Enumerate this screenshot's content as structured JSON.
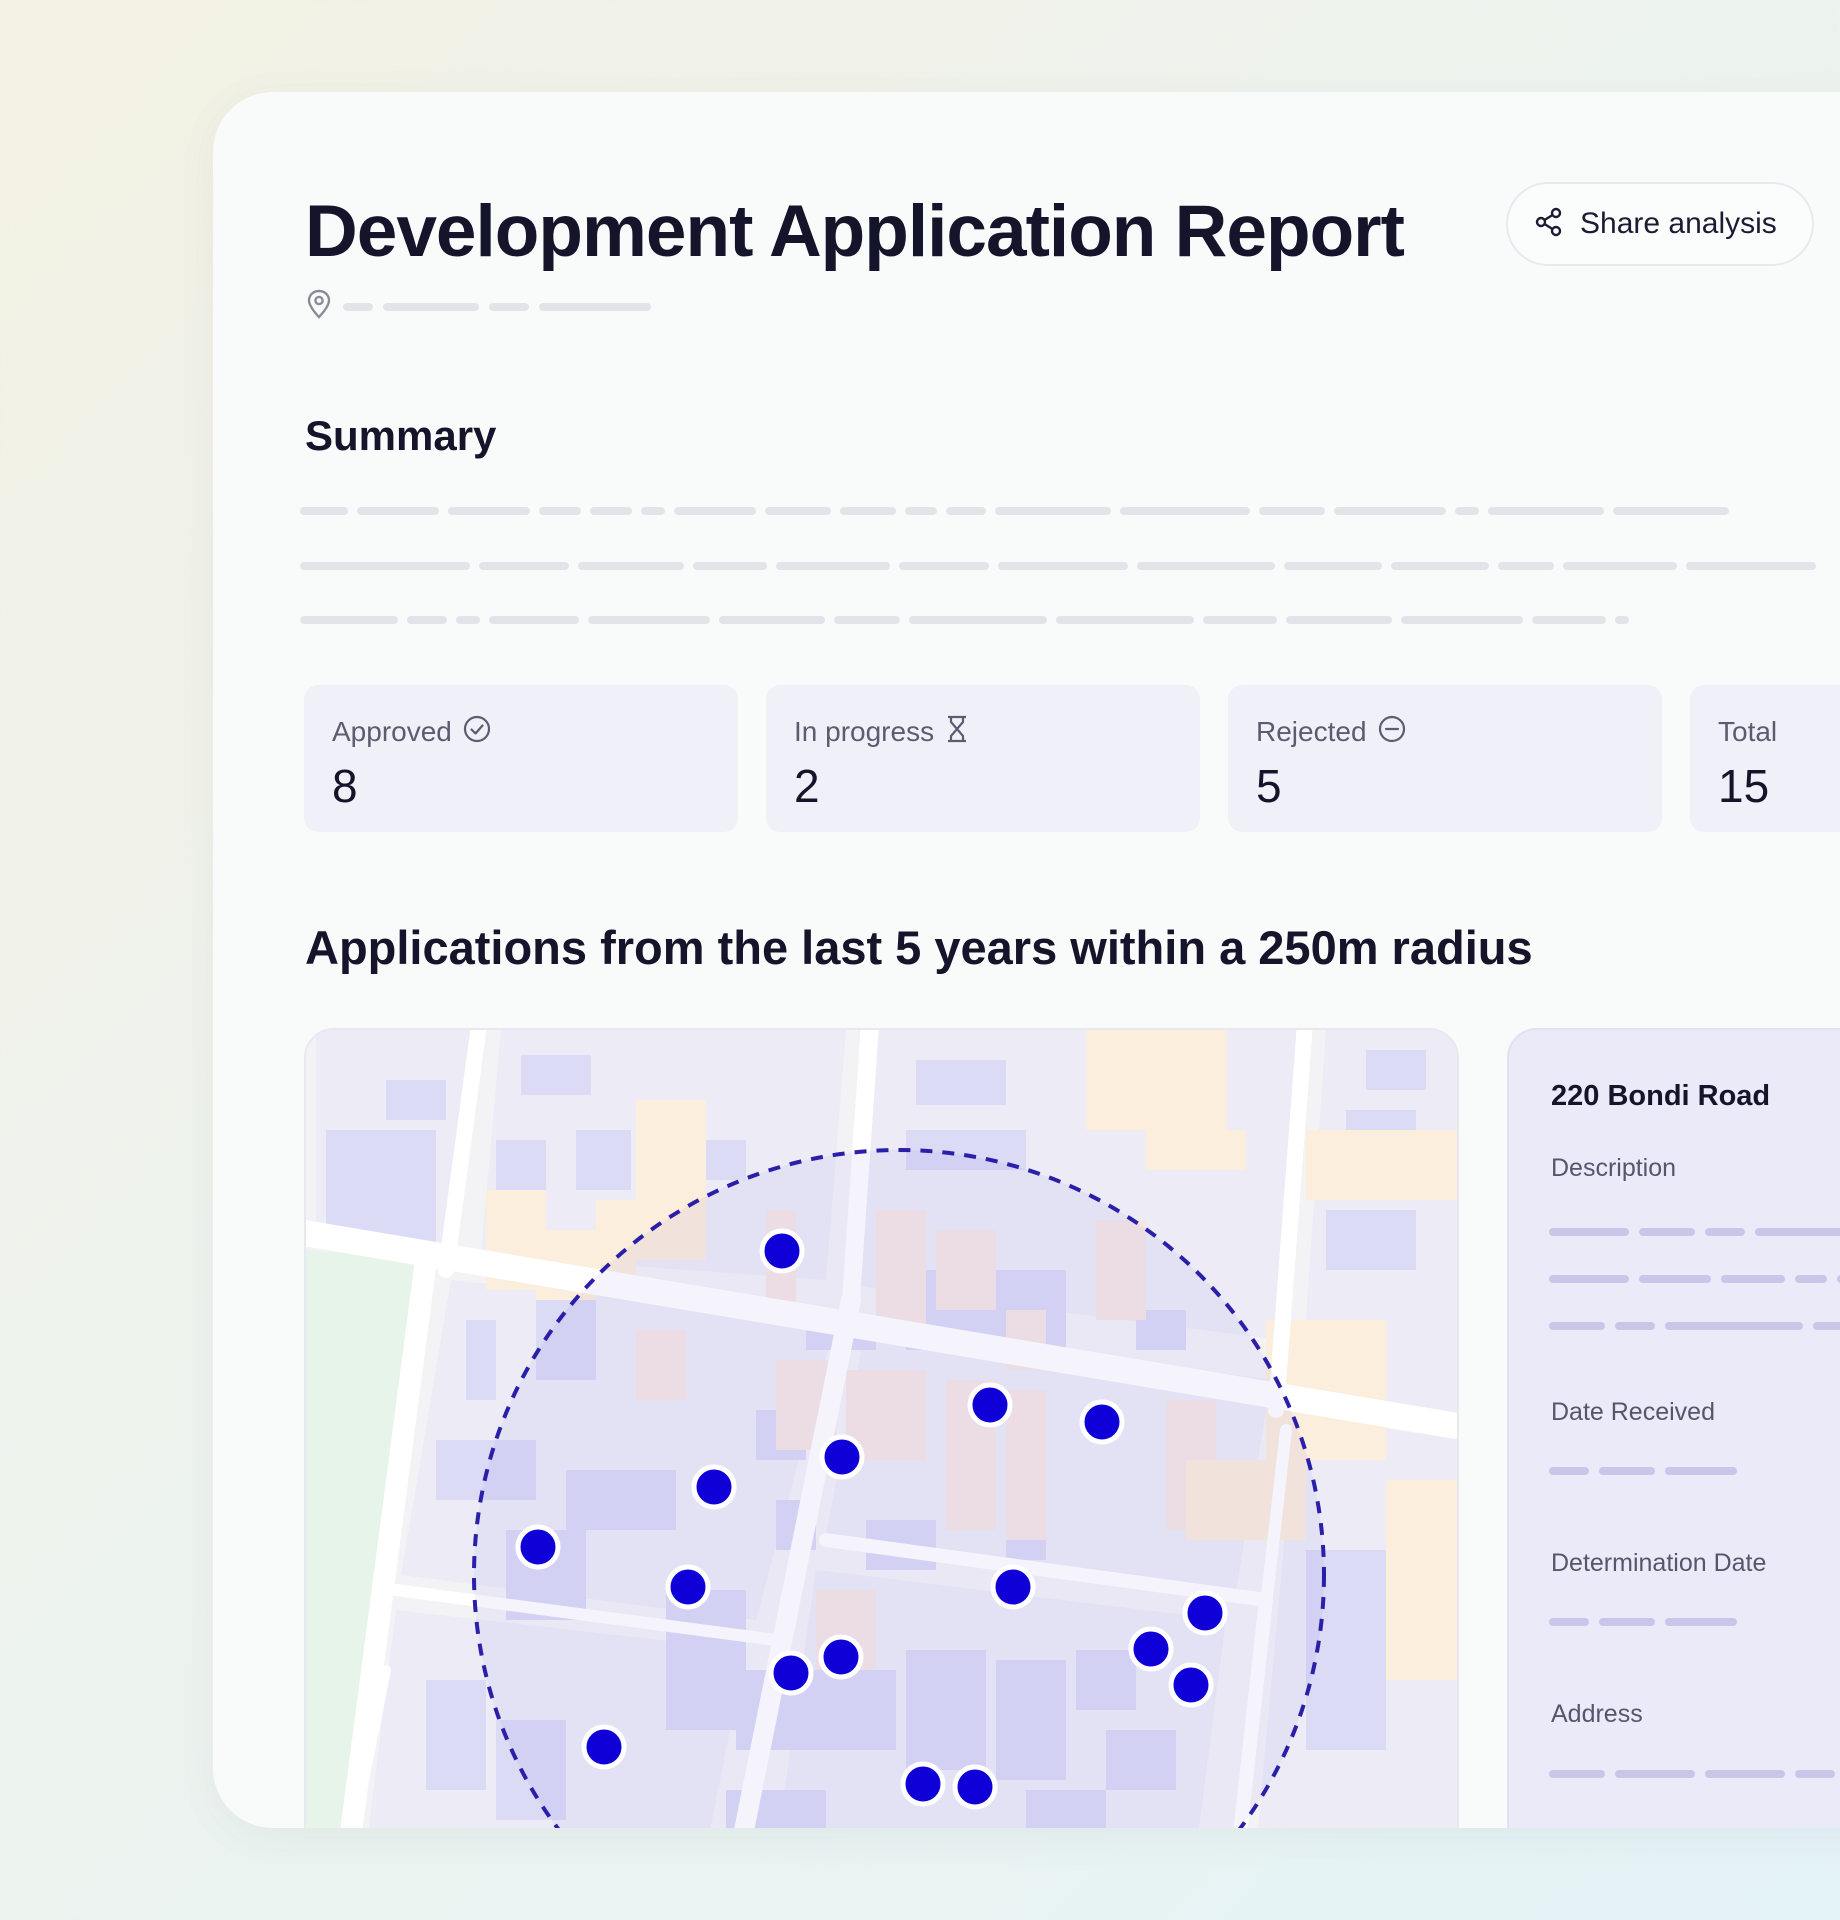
{
  "report": {
    "title": "Development Application Report",
    "share_label": "Share analysis"
  },
  "icons": {
    "share": "share-icon",
    "location": "location-pin-icon",
    "approved": "check-circle-icon",
    "in_progress": "hourglass-icon",
    "rejected": "minus-circle-icon"
  },
  "summary": {
    "title": "Summary",
    "stats": [
      {
        "label": "Approved",
        "value": "8"
      },
      {
        "label": "In progress",
        "value": "2"
      },
      {
        "label": "Rejected",
        "value": "5"
      },
      {
        "label": "Total",
        "value": "15"
      }
    ]
  },
  "applications": {
    "title": "Applications from the last 5 years within a 250m radius"
  },
  "detail": {
    "address_title": "220 Bondi Road",
    "labels": [
      "Description",
      "Date Received",
      "Determination Date",
      "Address"
    ]
  },
  "colors": {
    "marker": "#1000d8",
    "radius_ring": "#2a1fa8",
    "accent_lavender": "#c9c6e9"
  }
}
